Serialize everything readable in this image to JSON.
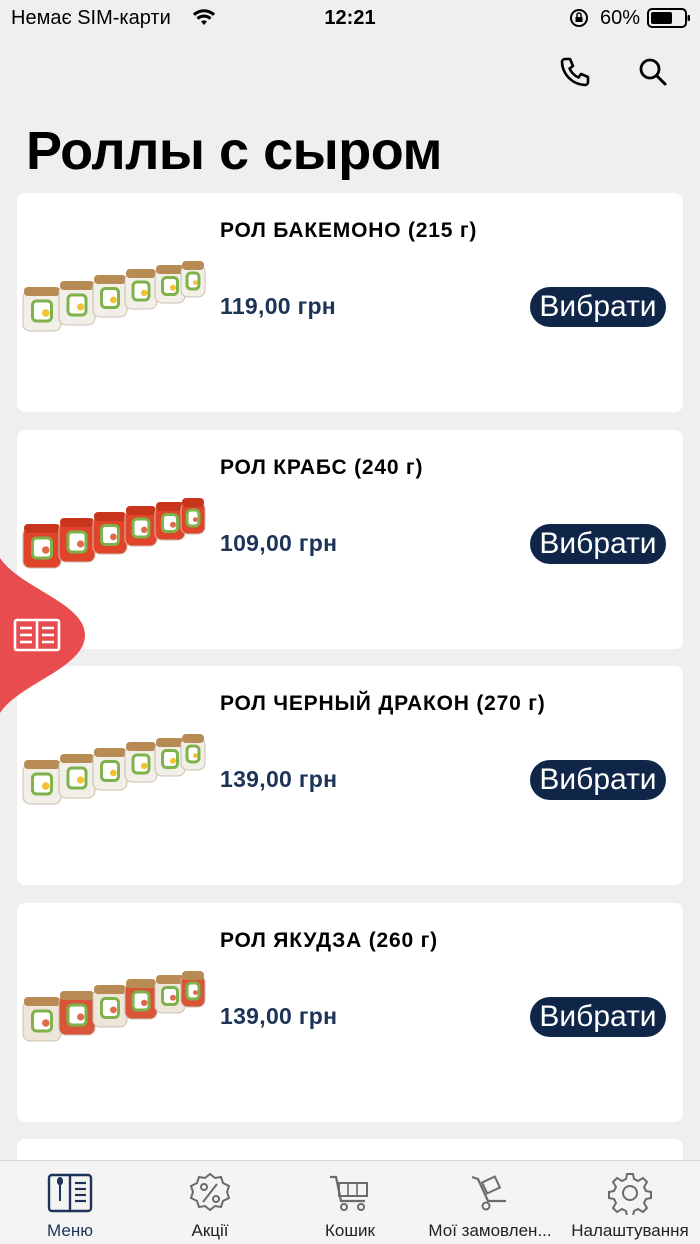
{
  "status_bar": {
    "carrier": "Немає SIM-карти",
    "time": "12:21",
    "battery": "60%"
  },
  "header": {
    "phone_icon": "phone-icon",
    "search_icon": "search-icon"
  },
  "page": {
    "title": "Роллы с сыром"
  },
  "products": [
    {
      "name": "РОЛ БАКЕМОНО (215 г)",
      "price": "119,00 грн",
      "button": "Вибрати",
      "image": "sushi-roll-bakemono"
    },
    {
      "name": "РОЛ КРАБС (240 г)",
      "price": "109,00 грн",
      "button": "Вибрати",
      "image": "sushi-roll-krabs"
    },
    {
      "name": "РОЛ ЧЕРНЫЙ ДРАКОН (270 г)",
      "price": "139,00 грн",
      "button": "Вибрати",
      "image": "sushi-roll-black-dragon"
    },
    {
      "name": "РОЛ ЯКУДЗА (260 г)",
      "price": "139,00 грн",
      "button": "Вибрати",
      "image": "sushi-roll-yakuza"
    }
  ],
  "side_tab": {
    "icon": "menu-book-icon"
  },
  "tab_bar": {
    "tabs": [
      {
        "label": "Меню",
        "icon": "menu-icon",
        "active": true
      },
      {
        "label": "Акції",
        "icon": "discount-icon",
        "active": false
      },
      {
        "label": "Кошик",
        "icon": "cart-icon",
        "active": false
      },
      {
        "label": "Мої замовлен...",
        "icon": "orders-icon",
        "active": false
      },
      {
        "label": "Налаштування",
        "icon": "settings-icon",
        "active": false
      }
    ]
  },
  "colors": {
    "accent": "#0f2649",
    "price": "#1d3358",
    "side_tab": "#e84c4f",
    "background": "#efefef"
  }
}
